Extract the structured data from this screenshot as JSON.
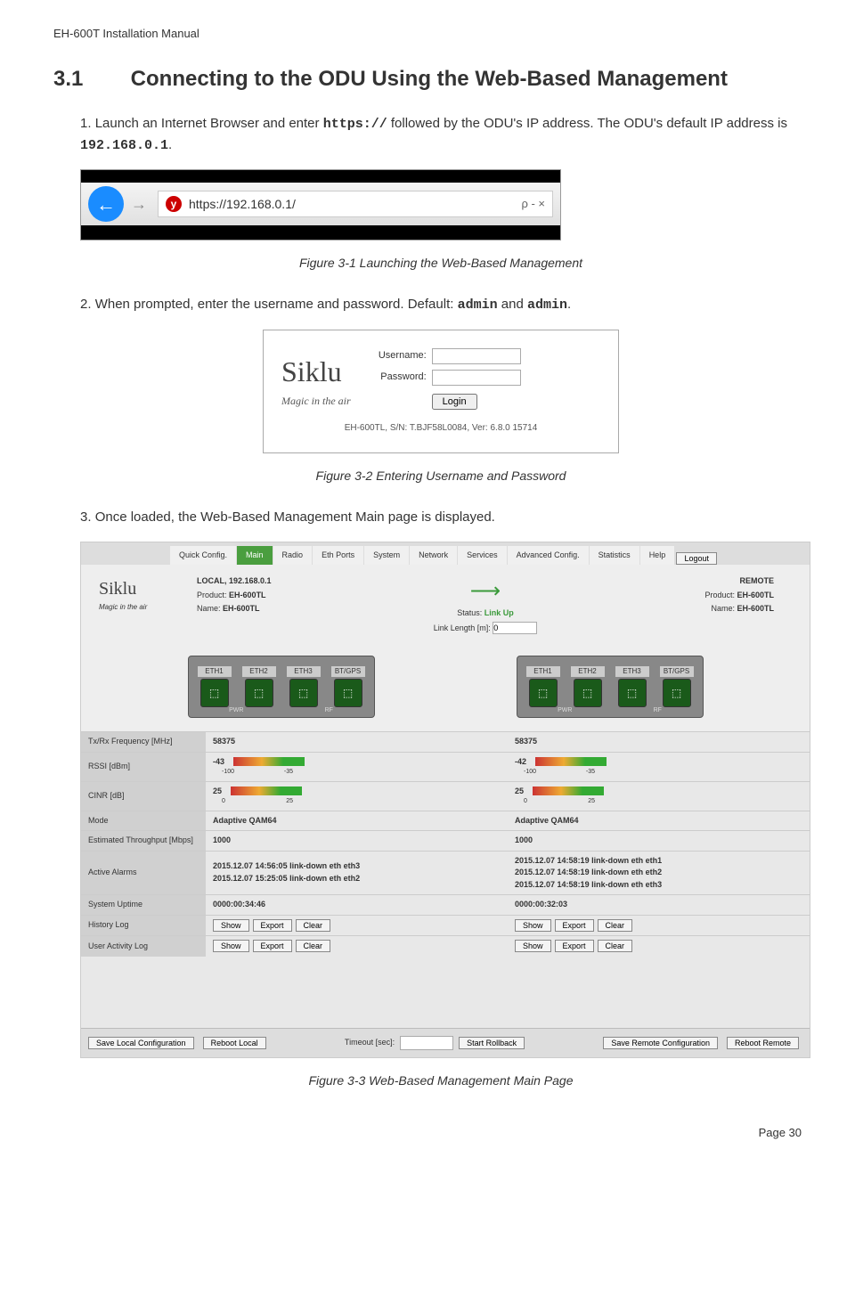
{
  "header": "EH-600T Installation Manual",
  "section": {
    "number": "3.1",
    "title": "Connecting to the ODU Using the Web-Based Management"
  },
  "steps": [
    {
      "num": "1.",
      "text_1": "Launch an Internet Browser and enter ",
      "code_1": "https://",
      "text_2": " followed by the ODU's IP address. The ODU's default IP address is ",
      "code_2": "192.168.0.1",
      "text_3": "."
    },
    {
      "num": "2.",
      "text_1": "When prompted, enter the username and password. Default: ",
      "code_1": "admin",
      "text_2": " and ",
      "code_2": "admin",
      "text_3": "."
    },
    {
      "num": "3.",
      "text_1": "Once loaded, the Web-Based Management Main page is displayed."
    }
  ],
  "captions": {
    "f1": "Figure 3-1 Launching the Web-Based Management",
    "f2": "Figure 3-2 Entering Username and Password",
    "f3": "Figure 3-3 Web-Based Management Main Page"
  },
  "browser": {
    "url": "https://192.168.0.1/",
    "icon_letter": "y",
    "right": "ρ - ×"
  },
  "login": {
    "brand": "Siklu",
    "tagline": "Magic in the air",
    "username_label": "Username:",
    "password_label": "Password:",
    "login_btn": "Login",
    "footer": "EH-600TL, S/N: T.BJF58L0084, Ver: 6.8.0 15714"
  },
  "webpage": {
    "tabs": [
      "Quick Config.",
      "Main",
      "Radio",
      "Eth Ports",
      "System",
      "Network",
      "Services",
      "Advanced Config.",
      "Statistics",
      "Help"
    ],
    "active_tab": "Main",
    "logout": "Logout",
    "local": {
      "title": "LOCAL, 192.168.0.1",
      "product_label": "Product:",
      "product": "EH-600TL",
      "name_label": "Name:",
      "name": "EH-600TL"
    },
    "center": {
      "status_label": "Status:",
      "status": "Link Up",
      "link_len_label": "Link Length [m]:",
      "link_len": "0"
    },
    "remote": {
      "title": "REMOTE",
      "product_label": "Product:",
      "product": "EH-600TL",
      "name_label": "Name:",
      "name": "EH-600TL"
    },
    "device_ports": [
      "ETH1",
      "ETH2",
      "ETH3",
      "BT/GPS"
    ],
    "device_bottom": [
      "PWR",
      "RF"
    ],
    "rows": [
      {
        "label": "Tx/Rx Frequency [MHz]",
        "local": "58375",
        "remote": "58375"
      },
      {
        "label": "RSSI [dBm]",
        "local": "-43",
        "remote": "-42",
        "gauge": true,
        "gmin": "-100",
        "gmax": "-35"
      },
      {
        "label": "CINR [dB]",
        "local": "25",
        "remote": "25",
        "gauge": true,
        "gmin": "0",
        "gmax": "25"
      },
      {
        "label": "Mode",
        "local": "Adaptive QAM64",
        "remote": "Adaptive QAM64"
      },
      {
        "label": "Estimated Throughput [Mbps]",
        "local": "1000",
        "remote": "1000"
      },
      {
        "label": "Active Alarms",
        "local_lines": [
          "2015.12.07 14:56:05 link-down eth eth3",
          "2015.12.07 15:25:05 link-down eth eth2"
        ],
        "remote_lines": [
          "2015.12.07 14:58:19 link-down eth eth1",
          "2015.12.07 14:58:19 link-down eth eth2",
          "2015.12.07 14:58:19 link-down eth eth3"
        ]
      },
      {
        "label": "System Uptime",
        "local": "0000:00:34:46",
        "remote": "0000:00:32:03"
      },
      {
        "label": "History Log",
        "buttons": [
          "Show",
          "Export",
          "Clear"
        ]
      },
      {
        "label": "User Activity Log",
        "buttons": [
          "Show",
          "Export",
          "Clear"
        ]
      }
    ],
    "footer": {
      "save_local": "Save Local Configuration",
      "reboot_local": "Reboot Local",
      "timeout_label": "Timeout [sec]:",
      "start_rollback": "Start Rollback",
      "save_remote": "Save Remote Configuration",
      "reboot_remote": "Reboot Remote"
    }
  },
  "page_number": "Page 30"
}
